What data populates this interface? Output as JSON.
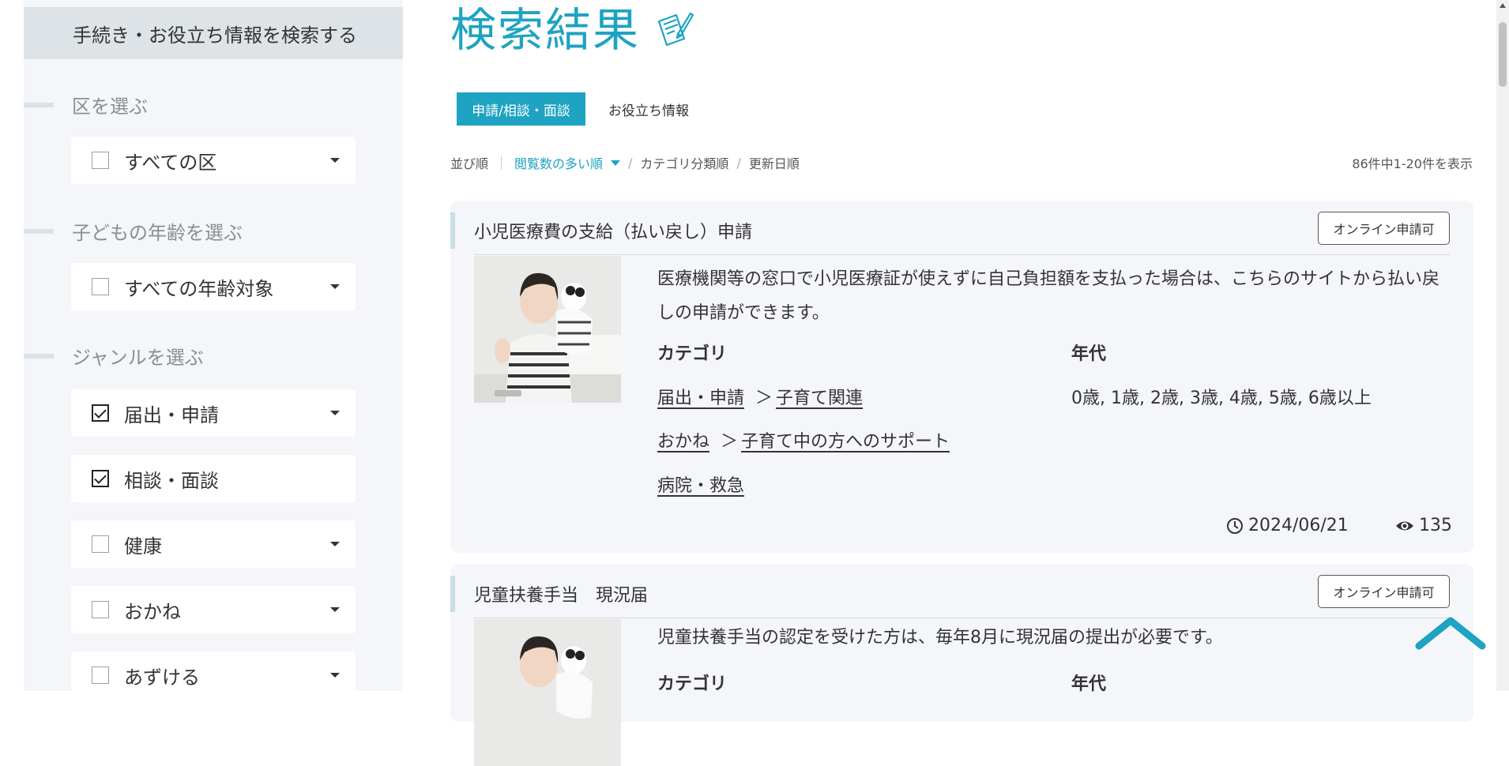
{
  "sidebar": {
    "header": "手続き・お役立ち情報を検索する",
    "ward_section": {
      "label": "区を選ぶ",
      "select": {
        "label": "すべての区",
        "checked": false
      }
    },
    "age_section": {
      "label": "子どもの年齢を選ぶ",
      "select": {
        "label": "すべての年齢対象",
        "checked": false
      }
    },
    "genre_section": {
      "label": "ジャンルを選ぶ",
      "items": [
        {
          "label": "届出・申請",
          "checked": true
        },
        {
          "label": "相談・面談",
          "checked": true
        },
        {
          "label": "健康",
          "checked": false
        },
        {
          "label": "おかね",
          "checked": false
        },
        {
          "label": "あずける",
          "checked": false
        }
      ]
    }
  },
  "main": {
    "title": "検索結果",
    "tabs": [
      {
        "label": "申請/相談・面談",
        "active": true
      },
      {
        "label": "お役立ち情報",
        "active": false
      }
    ],
    "sort": {
      "label": "並び順",
      "options": [
        "閲覧数の多い順",
        "カテゴリ分類順",
        "更新日順"
      ],
      "active": "閲覧数の多い順"
    },
    "result_count": "86件中1-20件を表示",
    "cards": [
      {
        "title": "小児医療費の支給（払い戻し）申請",
        "badge": "オンライン申請可",
        "description": "医療機関等の窓口で小児医療証が使えずに自己負担額を支払った場合は、こちらのサイトから払い戻しの申請ができます。",
        "category_header": "カテゴリ",
        "age_header": "年代",
        "categories": [
          {
            "parent": "届出・申請",
            "sep": "＞",
            "child": "子育て関連"
          },
          {
            "parent": "おかね",
            "sep": "＞",
            "child": "子育て中の方へのサポート"
          },
          {
            "parent": "病院・救急",
            "sep": "",
            "child": ""
          }
        ],
        "ages": "0歳, 1歳, 2歳, 3歳, 4歳, 5歳, 6歳以上",
        "date": "2024/06/21",
        "views": "135"
      },
      {
        "title": "児童扶養手当　現況届",
        "badge": "オンライン申請可",
        "description": "児童扶養手当の認定を受けた方は、毎年8月に現況届の提出が必要です。",
        "category_header": "カテゴリ",
        "age_header": "年代"
      }
    ]
  },
  "colors": {
    "accent": "#1ea3c2",
    "sidebar_bg": "#f4f6f9",
    "card_bg": "#f4f6f9"
  },
  "icons": [
    "pencil-paper-icon",
    "clock-icon",
    "eye-icon",
    "chevron-up-icon",
    "caret-down-icon",
    "checkbox-icon"
  ]
}
